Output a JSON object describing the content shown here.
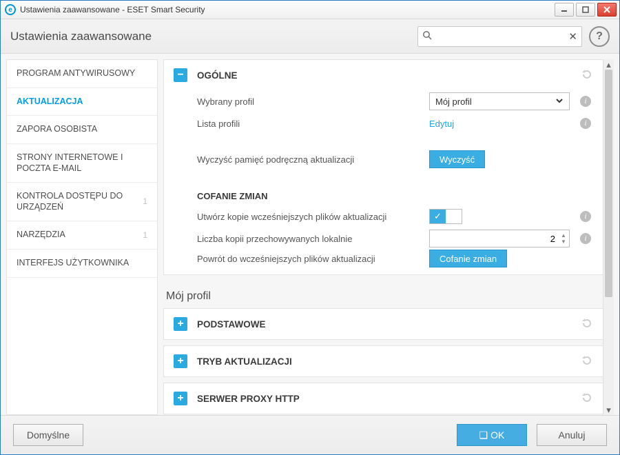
{
  "window": {
    "title": "Ustawienia zaawansowane - ESET Smart Security"
  },
  "header": {
    "breadcrumb": "Ustawienia zaawansowane",
    "search_placeholder": ""
  },
  "sidebar": {
    "items": [
      {
        "label": "PROGRAM ANTYWIRUSOWY",
        "count": ""
      },
      {
        "label": "AKTUALIZACJA",
        "count": ""
      },
      {
        "label": "ZAPORA OSOBISTA",
        "count": ""
      },
      {
        "label": "STRONY INTERNETOWE I POCZTA E-MAIL",
        "count": ""
      },
      {
        "label": "KONTROLA DOSTĘPU DO URZĄDZEŃ",
        "count": "1"
      },
      {
        "label": "NARZĘDZIA",
        "count": "1"
      },
      {
        "label": "INTERFEJS UŻYTKOWNIKA",
        "count": ""
      }
    ]
  },
  "general": {
    "title": "OGÓLNE",
    "profile_label": "Wybrany profil",
    "profile_value": "Mój profil",
    "list_label": "Lista profili",
    "list_action": "Edytuj",
    "clear_label": "Wyczyść pamięć podręczną aktualizacji",
    "clear_action": "Wyczyść",
    "rollback_title": "COFANIE ZMIAN",
    "snapshot_label": "Utwórz kopie wcześniejszych plików aktualizacji",
    "copies_label": "Liczba kopii przechowywanych lokalnie",
    "copies_value": "2",
    "revert_label": "Powrót do wcześniejszych plików aktualizacji",
    "revert_action": "Cofanie zmian"
  },
  "profile_section": {
    "title": "Mój profil"
  },
  "panels": {
    "basic": "PODSTAWOWE",
    "mode": "TRYB AKTUALIZACJI",
    "proxy": "SERWER PROXY HTTP"
  },
  "footer": {
    "defaults": "Domyślne",
    "ok": "OK",
    "cancel": "Anuluj"
  },
  "icons": {
    "expand_minus": "−",
    "expand_plus": "+",
    "help": "?",
    "check": "✓",
    "chevron": "⌄",
    "spin_up": "▲",
    "spin_down": "▼",
    "reset": "↺",
    "clear": "✕",
    "search": "🔍",
    "shield": "⬚"
  }
}
